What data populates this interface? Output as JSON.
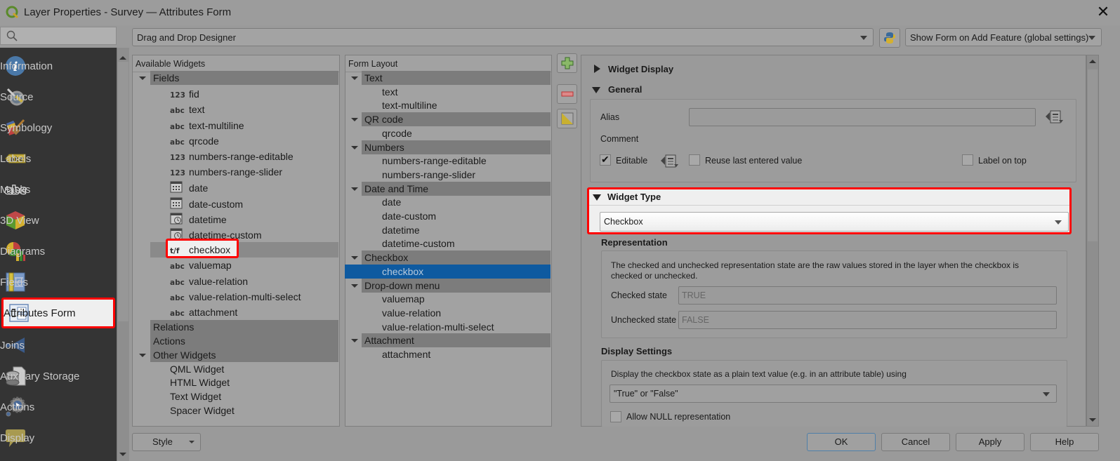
{
  "window": {
    "title": "Layer Properties - Survey — Attributes Form",
    "close_icon": "close-icon",
    "logo_icon": "qgis-logo-icon"
  },
  "search": {
    "placeholder": "",
    "icon": "search-icon"
  },
  "sidebar": {
    "items": [
      {
        "label": "Information",
        "icon": "information-icon"
      },
      {
        "label": "Source",
        "icon": "source-icon"
      },
      {
        "label": "Symbology",
        "icon": "symbology-icon"
      },
      {
        "label": "Labels",
        "icon": "labels-icon"
      },
      {
        "label": "Masks",
        "icon": "masks-icon"
      },
      {
        "label": "3D View",
        "icon": "3d-view-icon"
      },
      {
        "label": "Diagrams",
        "icon": "diagrams-icon"
      },
      {
        "label": "Fields",
        "icon": "fields-icon"
      },
      {
        "label": "Attributes Form",
        "icon": "attributes-form-icon",
        "active": true
      },
      {
        "label": "Joins",
        "icon": "joins-icon"
      },
      {
        "label": "Auxiliary Storage",
        "icon": "auxiliary-storage-icon"
      },
      {
        "label": "Actions",
        "icon": "actions-icon"
      },
      {
        "label": "Display",
        "icon": "display-icon"
      }
    ]
  },
  "toolbar": {
    "designer_mode": "Drag and Drop Designer",
    "python_icon": "python-icon",
    "show_form_mode": "Show Form on Add Feature (global settings)"
  },
  "available_widgets": {
    "header": "Available Widgets",
    "fields_group": "Fields",
    "fields": [
      {
        "type": "123",
        "name": "fid"
      },
      {
        "type": "abc",
        "name": "text"
      },
      {
        "type": "abc",
        "name": "text-multiline"
      },
      {
        "type": "abc",
        "name": "qrcode"
      },
      {
        "type": "123",
        "name": "numbers-range-editable"
      },
      {
        "type": "123",
        "name": "numbers-range-slider"
      },
      {
        "type": "date",
        "name": "date"
      },
      {
        "type": "date",
        "name": "date-custom"
      },
      {
        "type": "datetime",
        "name": "datetime"
      },
      {
        "type": "datetime",
        "name": "datetime-custom"
      },
      {
        "type": "t/f",
        "name": "checkbox",
        "highlighted": true
      },
      {
        "type": "abc",
        "name": "valuemap"
      },
      {
        "type": "abc",
        "name": "value-relation"
      },
      {
        "type": "abc",
        "name": "value-relation-multi-select"
      },
      {
        "type": "abc",
        "name": "attachment"
      }
    ],
    "relations_group": "Relations",
    "actions_group": "Actions",
    "other_group": "Other Widgets",
    "other": [
      "QML Widget",
      "HTML Widget",
      "Text Widget",
      "Spacer Widget"
    ]
  },
  "form_layout": {
    "header": "Form Layout",
    "groups": [
      {
        "name": "Text",
        "items": [
          "text",
          "text-multiline"
        ]
      },
      {
        "name": "QR code",
        "items": [
          "qrcode"
        ]
      },
      {
        "name": "Numbers",
        "items": [
          "numbers-range-editable",
          "numbers-range-slider"
        ]
      },
      {
        "name": "Date and Time",
        "items": [
          "date",
          "date-custom",
          "datetime",
          "datetime-custom"
        ]
      },
      {
        "name": "Checkbox",
        "items": [
          "checkbox"
        ],
        "selected_item": "checkbox"
      },
      {
        "name": "Drop-down menu",
        "items": [
          "valuemap",
          "value-relation",
          "value-relation-multi-select"
        ]
      },
      {
        "name": "Attachment",
        "items": [
          "attachment"
        ]
      }
    ]
  },
  "tools": {
    "add": "add-container-icon",
    "remove": "remove-icon",
    "invert": "invert-selection-icon"
  },
  "properties": {
    "widget_display": "Widget Display",
    "general": {
      "title": "General",
      "alias_label": "Alias",
      "alias_value": "",
      "comment_label": "Comment",
      "editable_label": "Editable",
      "editable_checked": true,
      "reuse_label": "Reuse last entered value",
      "reuse_checked": false,
      "label_on_top": "Label on top",
      "label_on_top_checked": false
    },
    "widget_type": {
      "title": "Widget Type",
      "value": "Checkbox"
    },
    "representation": {
      "title": "Representation",
      "description_line1": "The checked and unchecked representation state are the raw values stored in the layer when the checkbox is",
      "description_line2": "checked or unchecked.",
      "checked_label": "Checked state",
      "checked_placeholder": "TRUE",
      "unchecked_label": "Unchecked state",
      "unchecked_placeholder": "FALSE"
    },
    "display_settings": {
      "title": "Display Settings",
      "description": "Display the checkbox state as a plain text value (e.g. in an attribute table) using",
      "value": "\"True\" or \"False\"",
      "allow_null_label": "Allow NULL representation",
      "allow_null_checked": false
    }
  },
  "footer": {
    "style": "Style",
    "ok": "OK",
    "cancel": "Cancel",
    "apply": "Apply",
    "help": "Help"
  },
  "colors": {
    "highlight": "#ff0000",
    "selection": "#0e5aa0",
    "sidebar_bg": "#343434"
  }
}
